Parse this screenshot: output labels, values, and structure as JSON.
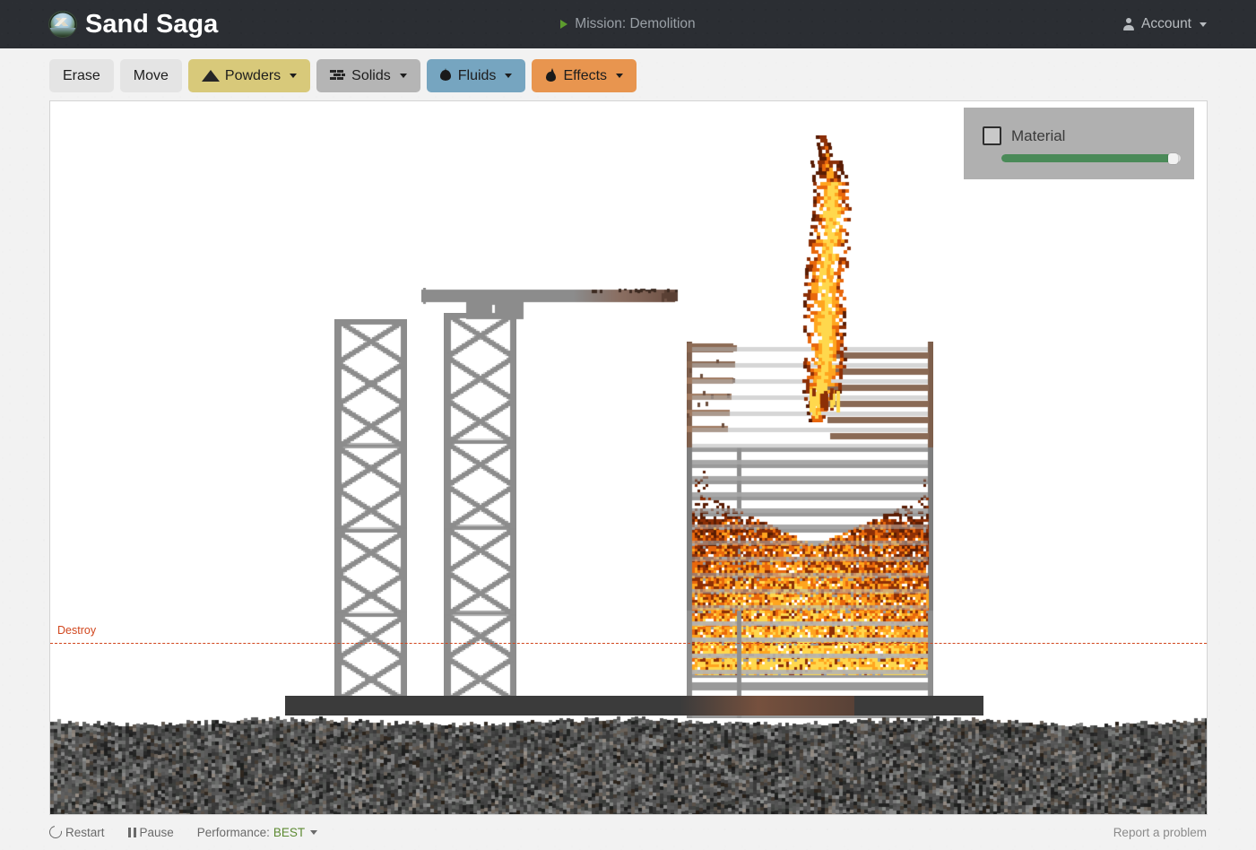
{
  "header": {
    "logo_icon": "mountain-lake-logo-icon",
    "title": "Sand Saga",
    "mission_icon": "play-triangle-icon",
    "mission_label": "Mission: Demolition",
    "account_icon": "person-icon",
    "account_label": "Account",
    "account_caret_icon": "chevron-down-icon",
    "background_color": "#2b2e33"
  },
  "toolbar": {
    "buttons": [
      {
        "label": "Erase",
        "icon": null,
        "variant": "plain",
        "caret": false,
        "color": "#e4e4e4"
      },
      {
        "label": "Move",
        "icon": null,
        "variant": "plain",
        "caret": false,
        "color": "#e4e4e4"
      },
      {
        "label": "Powders",
        "icon": "mountain-icon",
        "variant": "powders",
        "caret": true,
        "color": "#d8c97a"
      },
      {
        "label": "Solids",
        "icon": "bricks-icon",
        "variant": "solids",
        "caret": true,
        "color": "#b5b5b5"
      },
      {
        "label": "Fluids",
        "icon": "droplet-icon",
        "variant": "fluids",
        "caret": true,
        "color": "#76a5c0"
      },
      {
        "label": "Effects",
        "icon": "flame-icon",
        "variant": "effects",
        "caret": true,
        "color": "#e8954f"
      }
    ]
  },
  "canvas": {
    "material_panel": {
      "checkbox_checked": false,
      "label": "Material",
      "slider_value": 97,
      "slider_min": 0,
      "slider_max": 100,
      "slider_fill_color": "#4a8a58",
      "panel_color": "#b0b0b0"
    },
    "destroy_marker": {
      "label": "Destroy",
      "color": "#d1461d",
      "style": "dashed"
    },
    "scene": {
      "description": "Demolition sandbox: two gray lattice towers with X-bracing, a crane boom, and a burning multi-storey building with a rising flame plume over dark rubble ground.",
      "ground_color": "#4a4a46",
      "foundation_color": "#3b3b3b",
      "tower_color": "#8c8c8c",
      "fire_colors": [
        "#ffd84d",
        "#ffa51f",
        "#e8670c",
        "#8c2f06",
        "#5a1d04"
      ]
    }
  },
  "footer": {
    "restart_icon": "restart-circular-arrow-icon",
    "restart_label": "Restart",
    "pause_icon": "pause-icon",
    "pause_label": "Pause",
    "performance_label": "Performance:",
    "performance_value": "BEST",
    "performance_caret_icon": "chevron-down-icon",
    "report_label": "Report a problem"
  }
}
